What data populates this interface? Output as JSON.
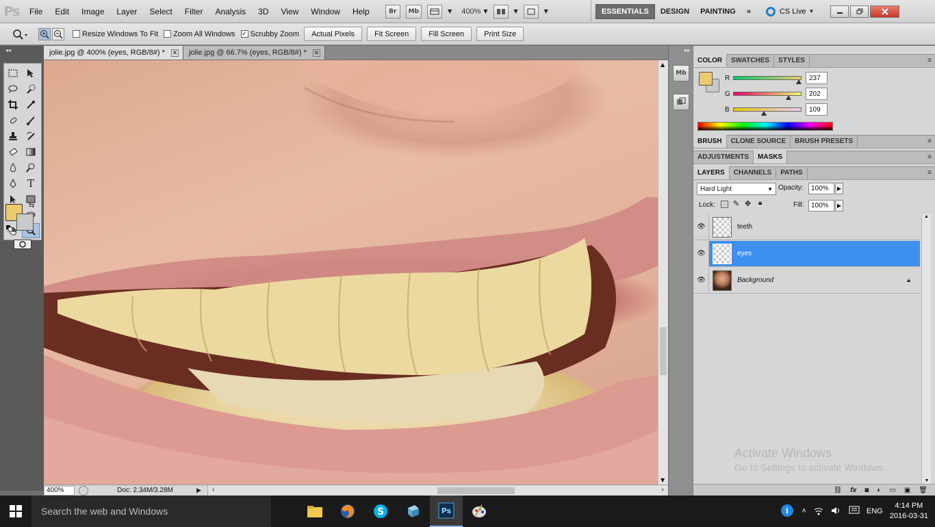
{
  "app": {
    "logo": "Ps",
    "menu": [
      "File",
      "Edit",
      "Image",
      "Layer",
      "Select",
      "Filter",
      "Analysis",
      "3D",
      "View",
      "Window",
      "Help"
    ],
    "bridge_label": "Br",
    "minibridge_label": "Mb",
    "zoom_level": "400%",
    "workspaces": [
      "ESSENTIALS",
      "DESIGN",
      "PAINTING"
    ],
    "more_workspaces": "»",
    "cs_live": "CS Live"
  },
  "options": {
    "resize_windows": "Resize Windows To Fit",
    "zoom_all": "Zoom All Windows",
    "scrubby_zoom": "Scrubby Zoom",
    "buttons": [
      "Actual Pixels",
      "Fit Screen",
      "Fill Screen",
      "Print Size"
    ]
  },
  "documents": {
    "tabs": [
      {
        "label": "jolie.jpg @ 400% (eyes, RGB/8#) *",
        "close": "✕"
      },
      {
        "label": "jolie.jpg @ 66.7% (eyes, RGB/8#) *",
        "close": "✕"
      }
    ]
  },
  "status": {
    "zoom": "400%",
    "doc_size": "Doc: 2.34M/3.28M"
  },
  "mini_dock": {
    "minibridge": "Mb"
  },
  "color_panel": {
    "tabs": [
      "COLOR",
      "SWATCHES",
      "STYLES"
    ],
    "channels": [
      {
        "letter": "R",
        "value": "237"
      },
      {
        "letter": "G",
        "value": "202"
      },
      {
        "letter": "B",
        "value": "109"
      }
    ],
    "foreground": "#edca6d",
    "background": "#c9c9c9"
  },
  "brush_panel": {
    "tabs": [
      "BRUSH",
      "CLONE SOURCE",
      "BRUSH PRESETS"
    ]
  },
  "adjust_panel": {
    "tabs": [
      "ADJUSTMENTS",
      "MASKS"
    ]
  },
  "layers_panel": {
    "tabs": [
      "LAYERS",
      "CHANNELS",
      "PATHS"
    ],
    "blend_mode": "Hard Light",
    "opacity_label": "Opacity:",
    "opacity": "100%",
    "lock_label": "Lock:",
    "fill_label": "Fill:",
    "fill": "100%",
    "layers": [
      {
        "name": "teeth",
        "selected": false
      },
      {
        "name": "eyes",
        "selected": true
      },
      {
        "name": "Background",
        "selected": false,
        "locked": true
      }
    ]
  },
  "watermark": {
    "title": "Activate Windows",
    "subtitle": "Go to Settings to activate Windows."
  },
  "taskbar": {
    "search_placeholder": "Search the web and Windows",
    "language": "ENG",
    "time": "4:14 PM",
    "date": "2016-03-31"
  }
}
